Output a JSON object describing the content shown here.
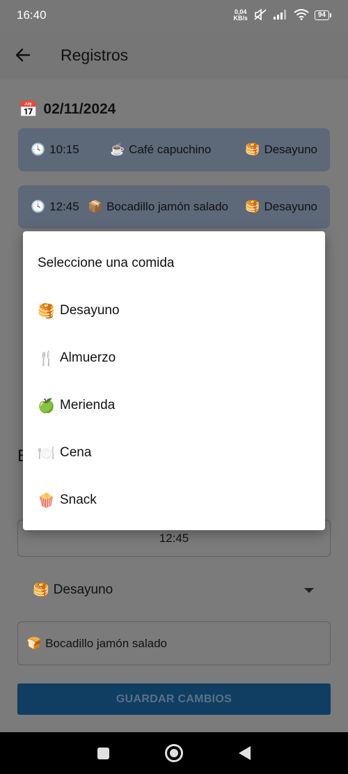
{
  "status_bar": {
    "time": "16:40",
    "net_speed_value": "0,04",
    "net_speed_unit": "KB/s",
    "battery": "94"
  },
  "app_bar": {
    "title": "Registros"
  },
  "records": {
    "date_icon": "📅",
    "date": "02/11/2024",
    "items": [
      {
        "clock_icon": "🕓",
        "time": "10:15",
        "food_icon": "☕",
        "food": "Café capuchino",
        "meal_icon": "🥞",
        "meal": "Desayuno"
      },
      {
        "clock_icon": "🕓",
        "time": "12:45",
        "food_icon": "📦",
        "food": "Bocadillo jamón salado",
        "meal_icon": "🥞",
        "meal": "Desayuno"
      }
    ]
  },
  "edit_sheet": {
    "title_fragment": "E",
    "time_value": "12:45",
    "meal_icon": "🥞",
    "meal_value": "Desayuno",
    "food_icon": "🍞",
    "food_value": "Bocadillo jamón salado",
    "save_label": "GUARDAR CAMBIOS"
  },
  "dialog": {
    "title": "Seleccione una comida",
    "options": [
      {
        "icon": "🥞",
        "label": "Desayuno"
      },
      {
        "icon": "🍴",
        "label": "Almuerzo"
      },
      {
        "icon": "🍏",
        "label": "Merienda"
      },
      {
        "icon": "🍽️",
        "label": "Cena"
      },
      {
        "icon": "🍿",
        "label": "Snack"
      }
    ]
  },
  "colors": {
    "accent": "#1565c0",
    "card": "#5d6879",
    "scrim": "#7b7b7b"
  }
}
